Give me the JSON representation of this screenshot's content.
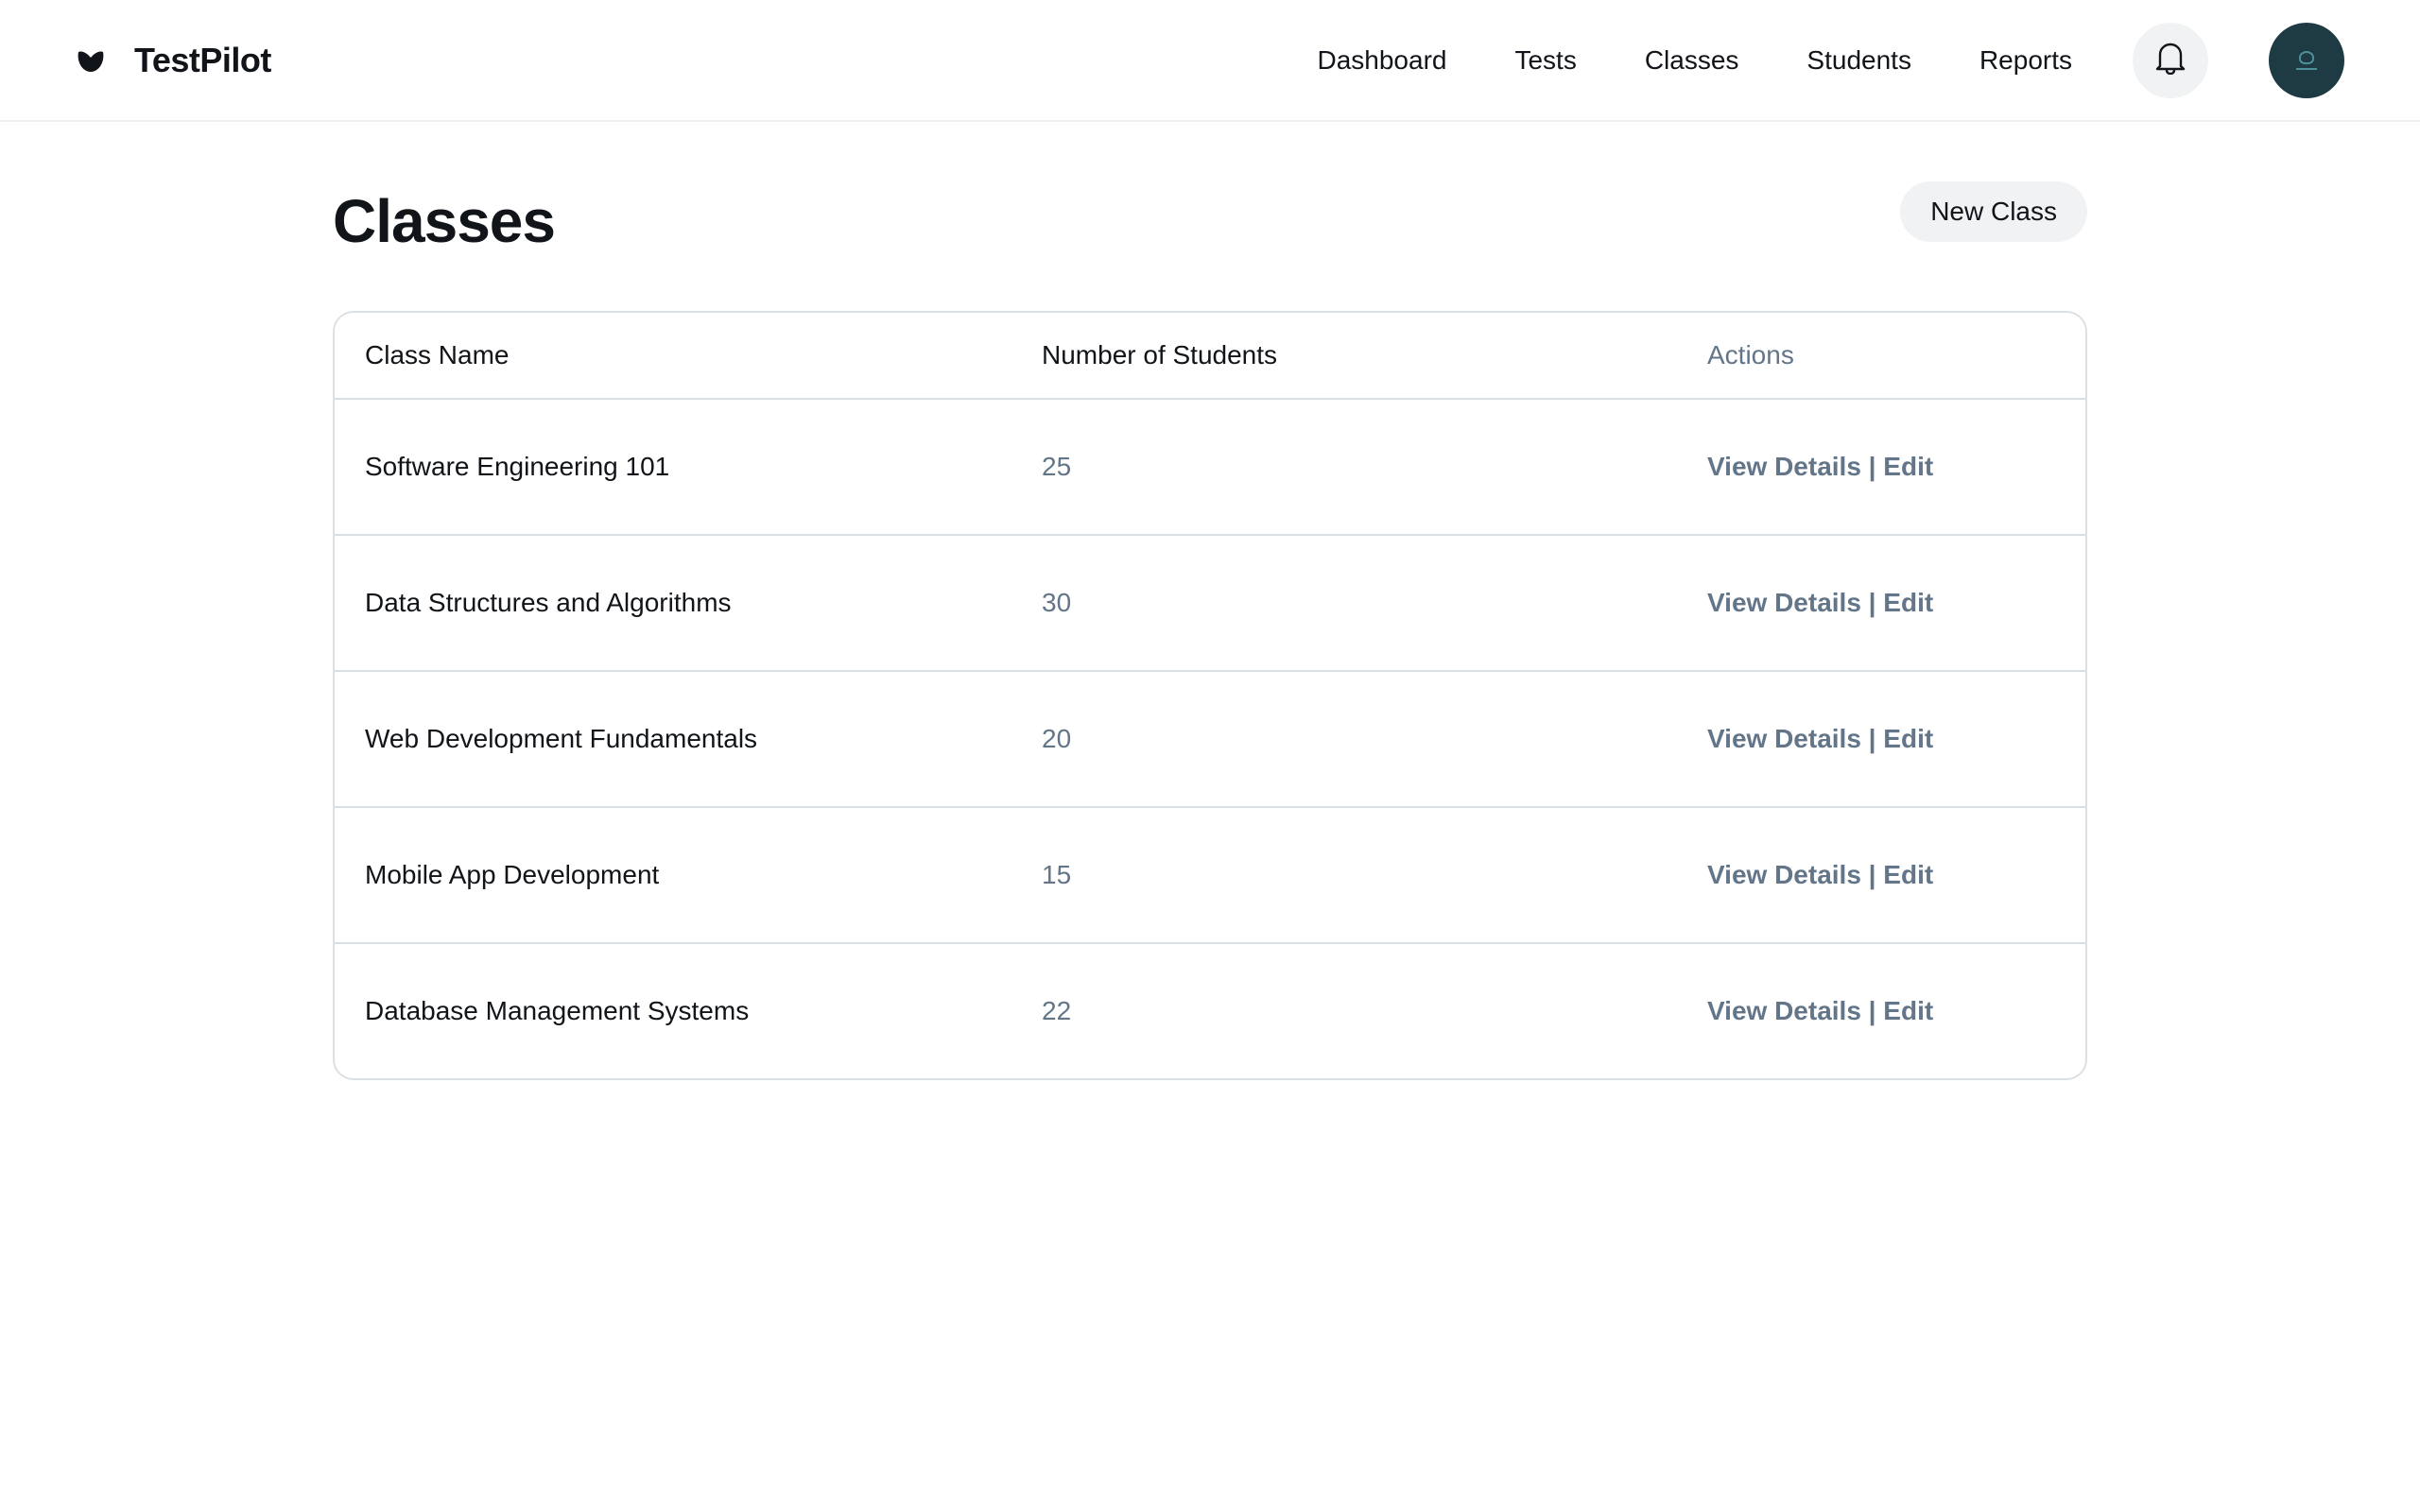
{
  "brand": {
    "name": "TestPilot",
    "logo_icon": "leaf-logo-icon"
  },
  "nav": {
    "links": [
      "Dashboard",
      "Tests",
      "Classes",
      "Students",
      "Reports"
    ],
    "bell_icon": "bell-icon",
    "avatar": "user-avatar"
  },
  "page": {
    "title": "Classes",
    "new_class_label": "New Class"
  },
  "table": {
    "headers": [
      "Class Name",
      "Number of Students",
      "Actions"
    ],
    "rows": [
      {
        "name": "Software Engineering 101",
        "students": "25",
        "actions": "View Details | Edit"
      },
      {
        "name": "Data Structures and Algorithms",
        "students": "30",
        "actions": "View Details | Edit"
      },
      {
        "name": "Web Development Fundamentals",
        "students": "20",
        "actions": "View Details | Edit"
      },
      {
        "name": "Mobile App Development",
        "students": "15",
        "actions": "View Details | Edit"
      },
      {
        "name": "Database Management Systems",
        "students": "22",
        "actions": "View Details | Edit"
      }
    ]
  },
  "colors": {
    "text_primary": "#111418",
    "text_muted": "#637588",
    "border": "#dbe0e5",
    "button_bg": "#f0f2f4",
    "avatar_bg": "#1e3a42"
  }
}
